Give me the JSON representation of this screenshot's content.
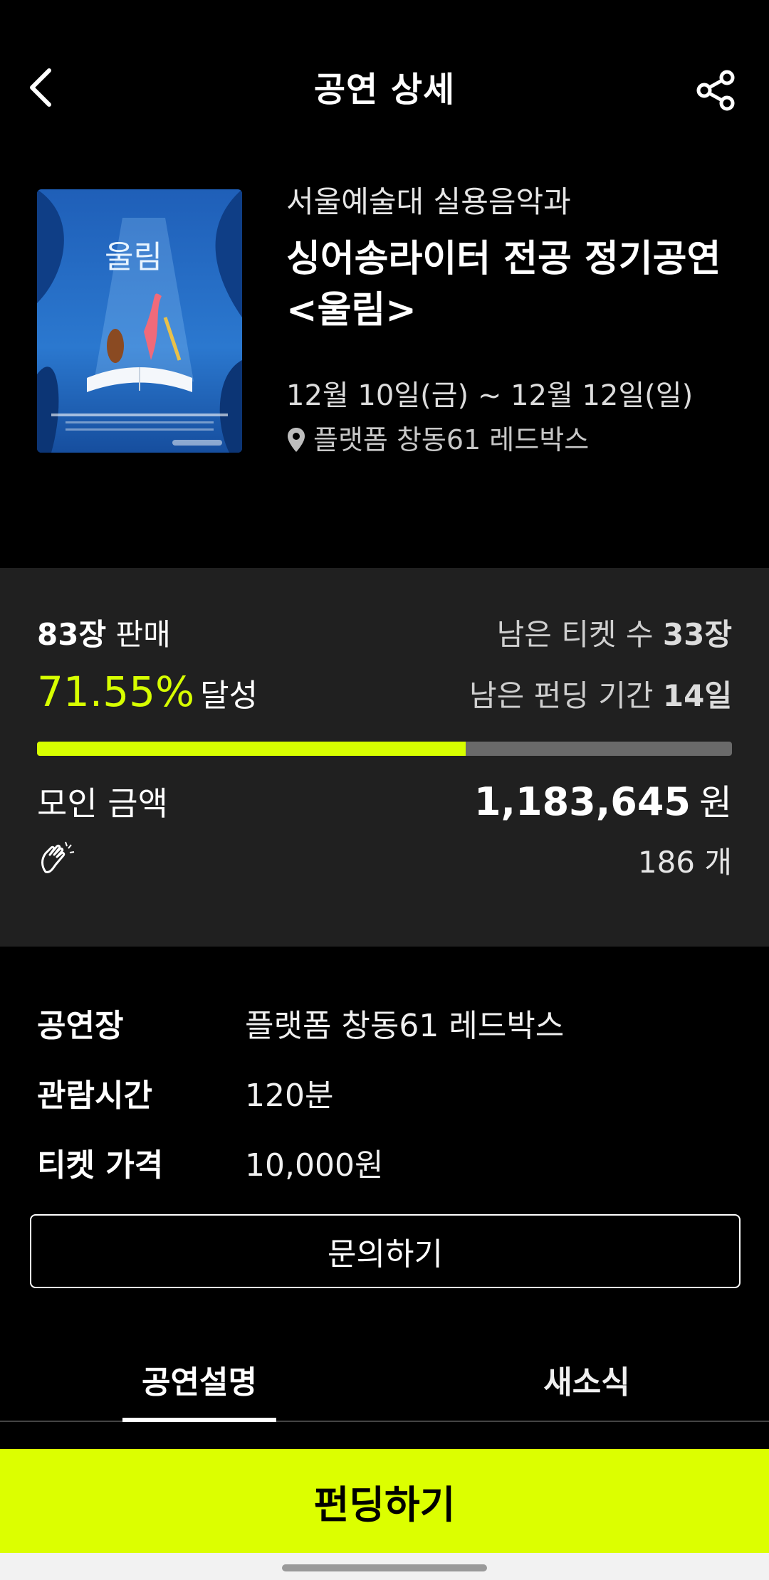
{
  "header": {
    "title": "공연 상세",
    "back_icon": "chevron-left-icon",
    "share_icon": "share-icon"
  },
  "event": {
    "poster_title": "울림",
    "organizer": "서울예술대 실용음악과",
    "title_line1": "싱어송라이터 전공 정기공연",
    "title_line2": "<울림>",
    "dates": "12월 10일(금) ~ 12월 12일(일)",
    "venue": "플랫폼 창동61 레드박스"
  },
  "funding": {
    "sold_count": "83장",
    "sold_label": "판매",
    "remaining_tickets_label": "남은 티켓 수",
    "remaining_tickets_value": "33장",
    "achievement_pct": "71.55%",
    "achievement_label": "달성",
    "remaining_period_label": "남은 펀딩 기간",
    "remaining_period_value": "14일",
    "progress_fraction": 0.617,
    "raised_label": "모인 금액",
    "raised_amount": "1,183,645",
    "raised_unit": "원",
    "cheer_count": "186 개"
  },
  "info": {
    "venue_label": "공연장",
    "venue_value": "플랫폼 창동61 레드박스",
    "duration_label": "관람시간",
    "duration_value": "120분",
    "price_label": "티켓 가격",
    "price_value": "10,000원"
  },
  "inquiry_button": "문의하기",
  "tabs": {
    "description": "공연설명",
    "news": "새소식"
  },
  "cta": "펀딩하기",
  "colors": {
    "accent": "#dcff00",
    "panel": "#202020",
    "background": "#000000"
  }
}
